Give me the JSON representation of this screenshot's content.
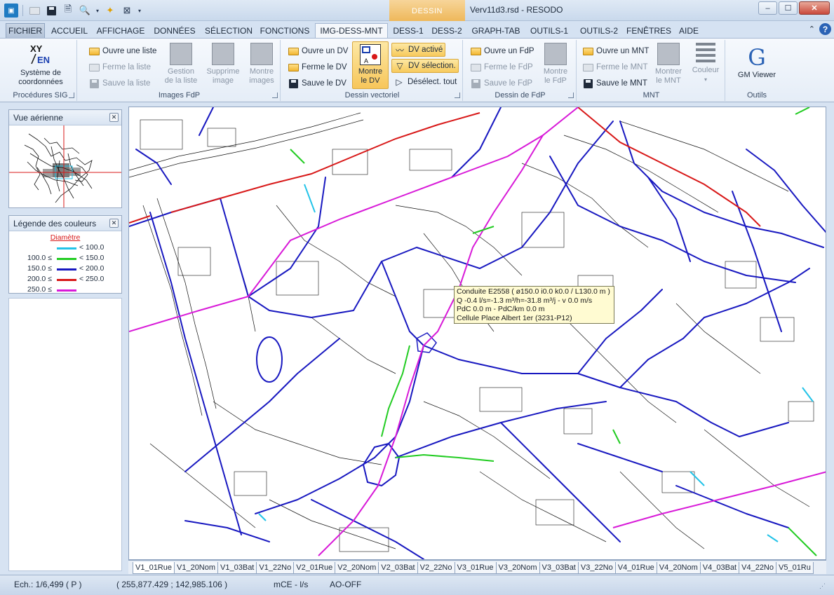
{
  "window": {
    "title": "Verv11d3.rsd - RESODO",
    "context_tab": "DESSIN",
    "controls": [
      "–",
      "☐",
      "✕"
    ]
  },
  "tabs": [
    {
      "label": "FICHIER"
    },
    {
      "label": "ACCUEIL"
    },
    {
      "label": "AFFICHAGE"
    },
    {
      "label": "DONNÉES"
    },
    {
      "label": "SÉLECTION"
    },
    {
      "label": "FONCTIONS"
    },
    {
      "label": "IMG-DESS-MNT"
    },
    {
      "label": "DESS-1"
    },
    {
      "label": "DESS-2"
    },
    {
      "label": "GRAPH-TAB"
    },
    {
      "label": "OUTILS-1"
    },
    {
      "label": "OUTILS-2"
    },
    {
      "label": "FENÊTRES"
    },
    {
      "label": "AIDE"
    }
  ],
  "ribbon": {
    "proc_sig": {
      "label": "Procédures SIG",
      "coord_button": "Système de\ncoordonnées",
      "coord_icon_text": "XY EN"
    },
    "images_fdp": {
      "label": "Images FdP",
      "open_list": "Ouvre une liste",
      "close_list": "Ferme la liste",
      "save_list": "Sauve la liste",
      "manage": "Gestion\nde la liste",
      "delete": "Supprime\nimage",
      "show": "Montre\nimages"
    },
    "dessin_vectoriel": {
      "label": "Dessin vectoriel",
      "open_dv": "Ouvre un DV",
      "close_dv": "Ferme le DV",
      "save_dv": "Sauve le DV",
      "show_dv": "Montre\nle DV",
      "dv_active": "DV activé",
      "dv_selection": "DV sélection.",
      "deselect_all": "Désélect. tout"
    },
    "dessin_fdp": {
      "label": "Dessin de FdP",
      "open_fdp": "Ouvre un FdP",
      "close_fdp": "Ferme le FdP",
      "save_fdp": "Sauve le FdP",
      "show_fdp": "Montre\nle FdP"
    },
    "mnt": {
      "label": "MNT",
      "open_mnt": "Ouvre un MNT",
      "close_mnt": "Ferme le MNT",
      "save_mnt": "Sauve le MNT",
      "show_mnt": "Montrer\nle MNT",
      "color": "Couleur"
    },
    "outils": {
      "label": "Outils",
      "gm_viewer": "GM Viewer"
    }
  },
  "aerial_panel": {
    "title": "Vue aérienne"
  },
  "legend_panel": {
    "title": "Légende des couleurs",
    "heading": "Diamètre",
    "rows": [
      {
        "from": "",
        "to": "< 100.0",
        "color": "#22c3e8"
      },
      {
        "from": "100.0 ≤",
        "to": "< 150.0",
        "color": "#22cc22"
      },
      {
        "from": "150.0 ≤",
        "to": "< 200.0",
        "color": "#1818c0"
      },
      {
        "from": "200.0 ≤",
        "to": "< 250.0",
        "color": "#d81818"
      },
      {
        "from": "250.0 ≤",
        "to": "",
        "color": "#d81ad8"
      }
    ]
  },
  "tooltip": {
    "line1": "Conduite E2558 ( ø150.0 i0.0 k0.0 / L130.0 m )",
    "line2": "Q -0.4 l/s=-1.3 m³/h=-31.8 m³/j - v 0.0 m/s",
    "line3": "PdC 0.0 m -  PdC/km 0.0 m",
    "line4": "Cellule Place Albert 1er (3231-P12)"
  },
  "sheet_tabs": [
    "V1_01Rue",
    "V1_20Nom",
    "V1_03Bat",
    "V1_22No",
    "V2_01Rue",
    "V2_20Nom",
    "V2_03Bat",
    "V2_22No",
    "V3_01Rue",
    "V3_20Nom",
    "V3_03Bat",
    "V3_22No",
    "V4_01Rue",
    "V4_20Nom",
    "V4_03Bat",
    "V4_22No",
    "V5_01Ru"
  ],
  "status": {
    "scale": "Ech.: 1/6,499   ( P )",
    "coords": "( 255,877.429 ; 142,985.106 )",
    "units": "mCE - l/s",
    "ao": "AO-OFF"
  },
  "colors": {
    "pipe_blue": "#1818c0",
    "pipe_red": "#d81818",
    "pipe_magenta": "#d81ad8",
    "pipe_green": "#22cc22",
    "pipe_cyan": "#22c3e8"
  }
}
